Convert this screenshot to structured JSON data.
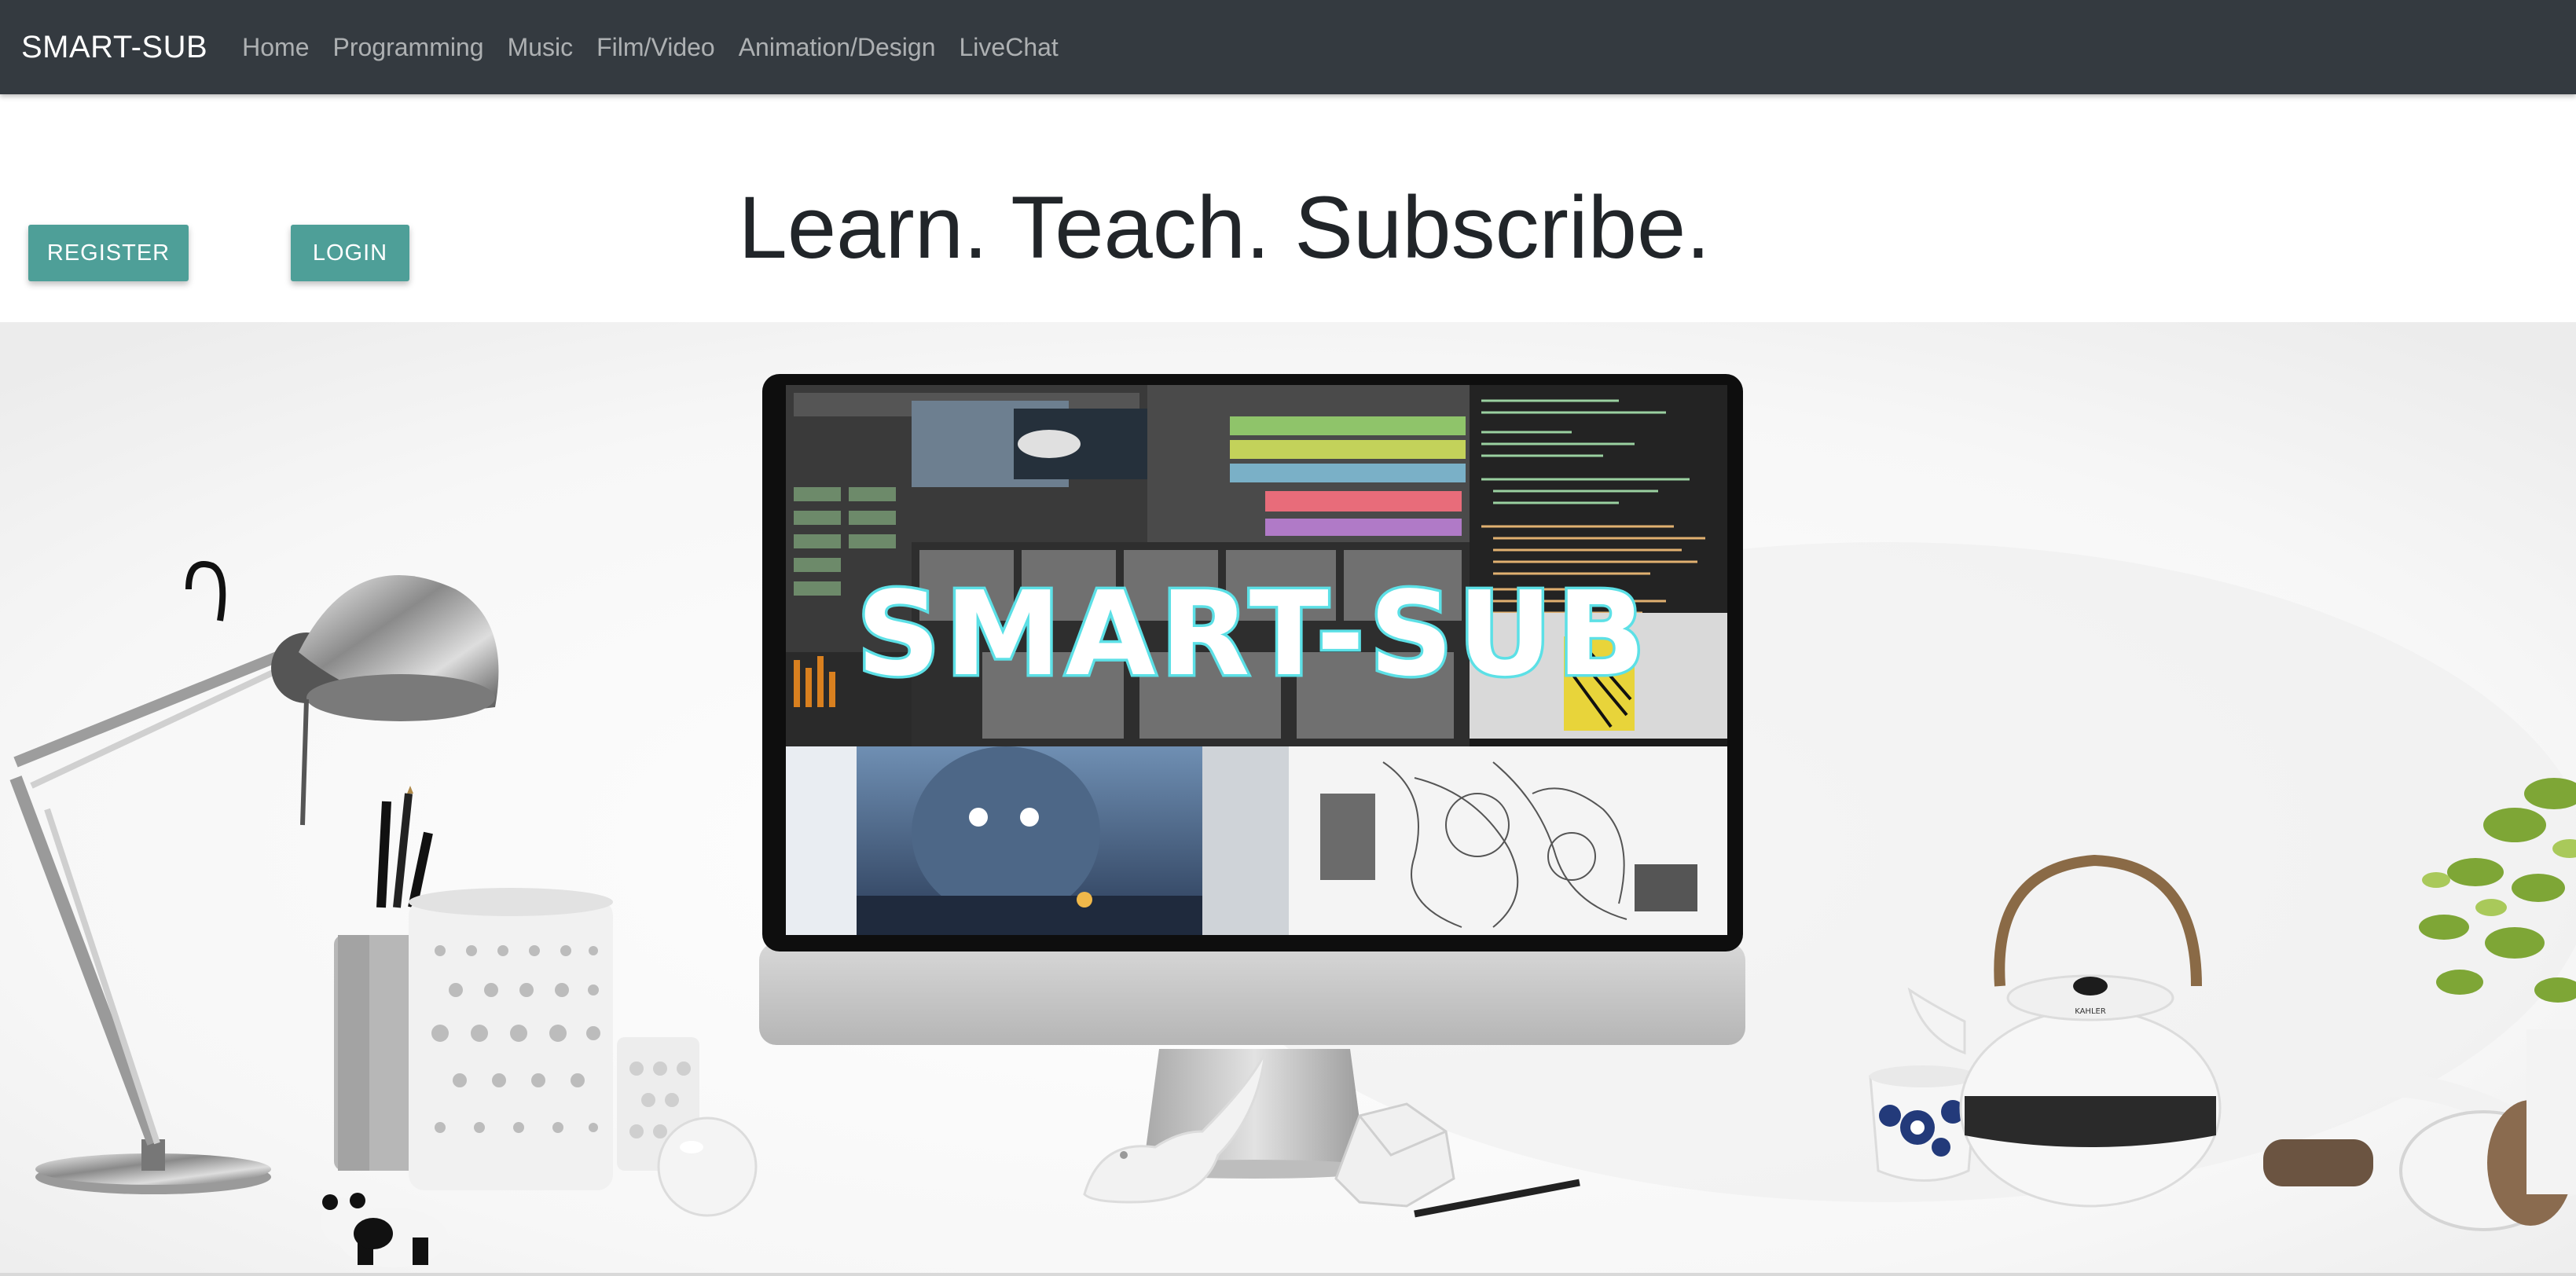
{
  "navbar": {
    "brand": "SMART-SUB",
    "links": [
      "Home",
      "Programming",
      "Music",
      "Film/Video",
      "Animation/Design",
      "LiveChat"
    ]
  },
  "actions": {
    "register_label": "REGISTER",
    "login_label": "LOGIN"
  },
  "hero": {
    "headline": "Learn. Teach. Subscribe.",
    "monitor_logo": "SMART-SUB",
    "teapot_brand": "KAHLER"
  },
  "colors": {
    "navbar_bg": "#343a40",
    "button_bg": "#4e9f98",
    "logo_outline": "#5ce0e6"
  }
}
